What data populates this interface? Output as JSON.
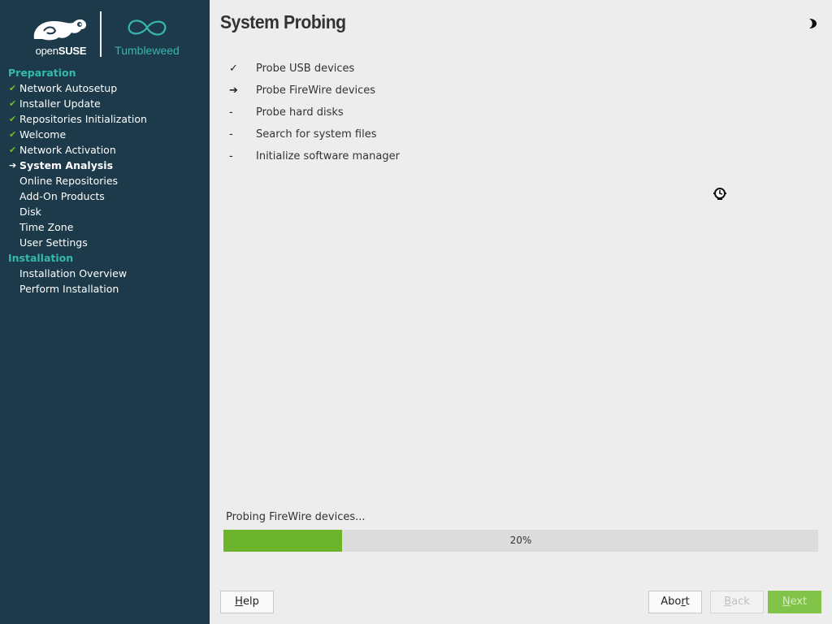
{
  "branding": {
    "vendor_light": "open",
    "vendor_bold": "SUSE",
    "product": "Tumbleweed",
    "accent_color": "#35b9ab",
    "sidebar_bg": "#1c3a4a"
  },
  "sidebar": {
    "sections": [
      {
        "title": "Preparation",
        "items": [
          {
            "label": "Network Autosetup",
            "state": "done"
          },
          {
            "label": "Installer Update",
            "state": "done"
          },
          {
            "label": "Repositories Initialization",
            "state": "done"
          },
          {
            "label": "Welcome",
            "state": "done"
          },
          {
            "label": "Network Activation",
            "state": "done"
          },
          {
            "label": "System Analysis",
            "state": "current"
          },
          {
            "label": "Online Repositories",
            "state": "todo"
          },
          {
            "label": "Add-On Products",
            "state": "todo"
          },
          {
            "label": "Disk",
            "state": "todo"
          },
          {
            "label": "Time Zone",
            "state": "todo"
          },
          {
            "label": "User Settings",
            "state": "todo"
          }
        ]
      },
      {
        "title": "Installation",
        "items": [
          {
            "label": "Installation Overview",
            "state": "todo"
          },
          {
            "label": "Perform Installation",
            "state": "todo"
          }
        ]
      }
    ]
  },
  "main": {
    "title": "System Probing",
    "tasks": [
      {
        "mark": "✓",
        "label": "Probe USB devices",
        "state": "done"
      },
      {
        "mark": "➔",
        "label": "Probe FireWire devices",
        "state": "current"
      },
      {
        "mark": "-",
        "label": "Probe hard disks",
        "state": "todo"
      },
      {
        "mark": "-",
        "label": "Search for system files",
        "state": "todo"
      },
      {
        "mark": "-",
        "label": "Initialize software manager",
        "state": "todo"
      }
    ],
    "status": "Probing FireWire devices...",
    "progress": {
      "percent": 20,
      "label": "20%",
      "fill_color": "#6cb42c"
    }
  },
  "buttons": {
    "help": {
      "pre": "",
      "mnemonic": "H",
      "post": "elp",
      "enabled": true
    },
    "abort": {
      "pre": "Abo",
      "mnemonic": "r",
      "post": "t",
      "enabled": true
    },
    "back": {
      "pre": "",
      "mnemonic": "B",
      "post": "ack",
      "enabled": false
    },
    "next": {
      "pre": "",
      "mnemonic": "N",
      "post": "ext",
      "enabled": false
    }
  },
  "icons": {
    "theme_toggle": "half-moon-icon",
    "busy": "busy-clock-cursor-icon",
    "done": "checkmark-icon",
    "current": "arrow-right-icon"
  }
}
